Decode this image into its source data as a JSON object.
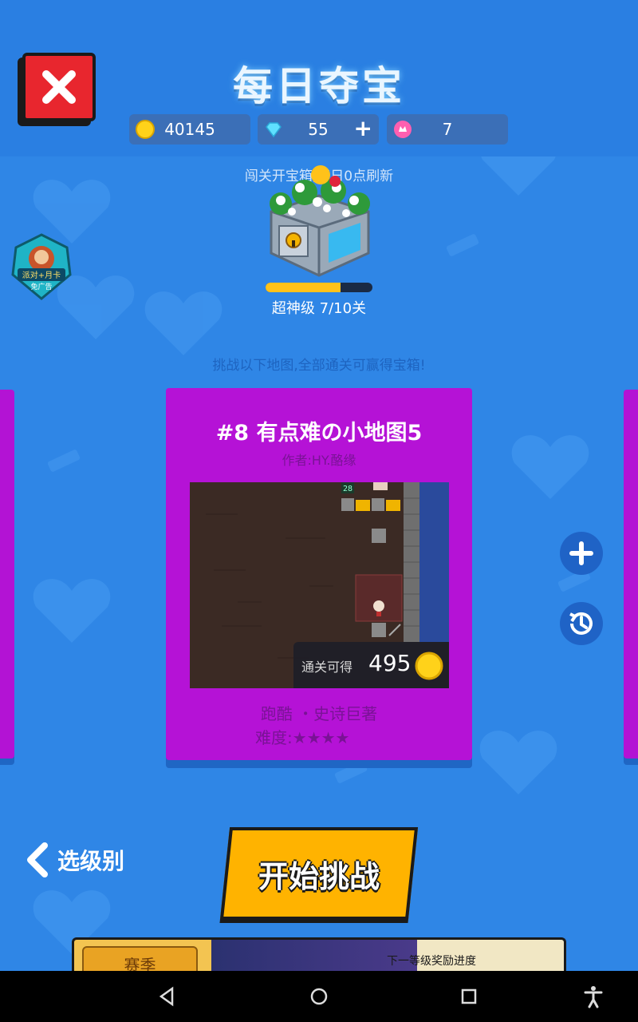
{
  "header": {
    "title": "每日夺宝",
    "coins": "40145",
    "gems": "55",
    "tokens": "7",
    "gem_plus": "+"
  },
  "chest": {
    "refresh_text": "闯关开宝箱,每日0点刷新",
    "progress": 0.7,
    "level_text": "超神级 7/10关"
  },
  "badge": {
    "line1": "派对+月卡",
    "line2": "免广告"
  },
  "challenge_hint": "挑战以下地图,全部通关可赢得宝箱!",
  "card": {
    "title": "#8 有点难の小地图5",
    "author": "作者:HY.酪缘",
    "reward_label": "通关可得",
    "reward_value": "495",
    "type": "跑酷 ・史诗巨著",
    "difficulty": "难度:★★★★",
    "map_number": "28"
  },
  "actions": {
    "back_label": "选级别",
    "start_label": "开始挑战"
  },
  "season": {
    "tag": "赛季",
    "next_reward": "下一等级奖励进度"
  },
  "colors": {
    "background": "#2f86e6",
    "card": "#b512d6",
    "start_button": "#ffb300",
    "close_button": "#e8262e"
  },
  "icons": [
    "close-icon",
    "coin-icon",
    "diamond-icon",
    "token-icon",
    "plus-icon",
    "history-icon",
    "back-chevron-icon",
    "nav-back-icon",
    "nav-home-icon",
    "nav-recents-icon",
    "accessibility-icon"
  ]
}
